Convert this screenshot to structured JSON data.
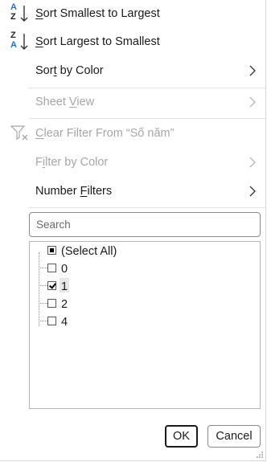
{
  "menu": {
    "sort_asc": {
      "label_pre": "",
      "accel": "S",
      "label_post": "ort Smallest to Largest",
      "icon_top": "A",
      "icon_bottom": "Z"
    },
    "sort_desc": {
      "label_pre": "",
      "accel": "S",
      "label_post": "ort Largest to Smallest",
      "icon_top": "Z",
      "icon_bottom": "A"
    },
    "sort_by_color": {
      "label_pre": "Sor",
      "accel": "t",
      "label_post": " by Color"
    },
    "sheet_view": {
      "label_pre": "Sheet ",
      "accel": "V",
      "label_post": "iew"
    },
    "clear_filter": {
      "label_pre": "",
      "accel": "C",
      "label_post": "lear Filter From “Số năm”"
    },
    "filter_by_color": {
      "label_pre": "F",
      "accel": "i",
      "label_post": "lter by Color"
    },
    "number_filters": {
      "label_pre": "Number ",
      "accel": "F",
      "label_post": "ilters"
    }
  },
  "search": {
    "placeholder": "Search",
    "value": ""
  },
  "list": {
    "items": [
      {
        "label": "(Select All)",
        "state": "indeterminate"
      },
      {
        "label": "0",
        "state": "unchecked"
      },
      {
        "label": "1",
        "state": "checked"
      },
      {
        "label": "2",
        "state": "unchecked"
      },
      {
        "label": "4",
        "state": "unchecked"
      }
    ]
  },
  "buttons": {
    "ok": "OK",
    "cancel": "Cancel"
  },
  "colors": {
    "accent_blue": "#1f6fd1",
    "disabled_text": "#a6a6a6"
  }
}
